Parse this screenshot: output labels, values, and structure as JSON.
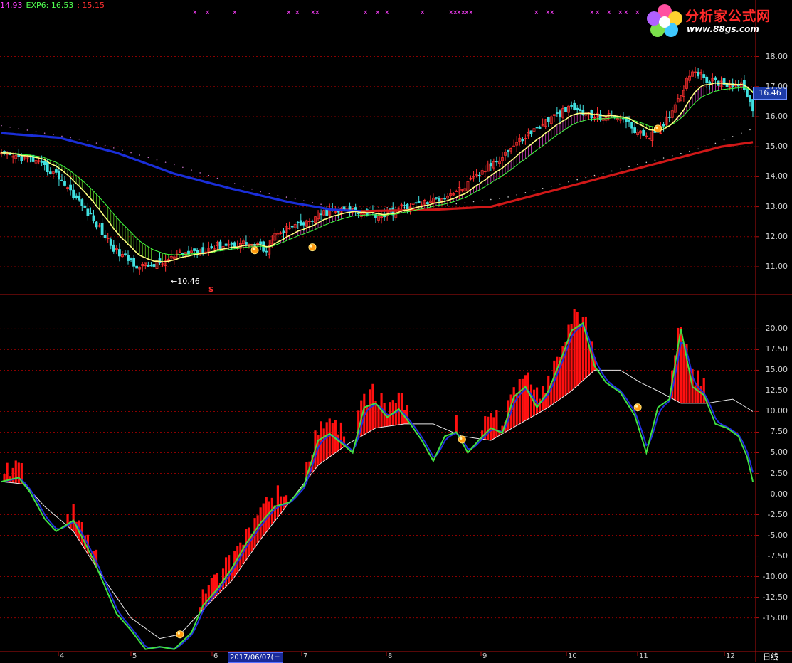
{
  "header": {
    "values": [
      {
        "text": "14.93",
        "color": "#ff40ff"
      },
      {
        "text": "EXP6: 16.53",
        "color": "#50ff50"
      },
      {
        "text": ": 15.15",
        "color": "#ff3030"
      }
    ]
  },
  "logo": {
    "title": "分析家公式网",
    "url": "www.88gs.com"
  },
  "price_tag": "16.46",
  "low_label": "10.46",
  "signal_label": "S",
  "date_box": "2017/06/07(三",
  "period_label": "日线",
  "colors": {
    "up": "#ff3030",
    "down": "#40e0e0",
    "grid": "#8a0000",
    "ma_long": "#1a2ed8",
    "ma_red": "#d01818",
    "ema_fast": "#ffff80"
  },
  "chart_data": [
    {
      "type": "candlestick",
      "panel": "price",
      "y_ticks": [
        "18.00",
        "17.00",
        "16.00",
        "15.00",
        "14.00",
        "13.00",
        "12.00",
        "11.00"
      ],
      "ylim": [
        10.1,
        18.7
      ],
      "x_ticks": [
        "4",
        "5",
        "6",
        "7",
        "8",
        "9",
        "10",
        "11",
        "12"
      ],
      "close_anchors": [
        [
          0,
          14.7
        ],
        [
          10,
          14.6
        ],
        [
          20,
          14.0
        ],
        [
          30,
          12.8
        ],
        [
          40,
          11.5
        ],
        [
          48,
          11.0
        ],
        [
          55,
          11.1
        ],
        [
          62,
          11.4
        ],
        [
          75,
          11.7
        ],
        [
          85,
          11.8
        ],
        [
          92,
          11.6
        ],
        [
          96,
          12.2
        ],
        [
          105,
          12.4
        ],
        [
          112,
          12.8
        ],
        [
          122,
          12.9
        ],
        [
          132,
          12.7
        ],
        [
          140,
          13.0
        ],
        [
          150,
          13.2
        ],
        [
          160,
          13.6
        ],
        [
          170,
          14.4
        ],
        [
          180,
          15.2
        ],
        [
          190,
          15.9
        ],
        [
          198,
          16.3
        ],
        [
          205,
          16.0
        ],
        [
          215,
          16.0
        ],
        [
          222,
          15.4
        ],
        [
          228,
          15.4
        ],
        [
          235,
          16.6
        ],
        [
          240,
          17.6
        ],
        [
          245,
          17.2
        ],
        [
          252,
          17.1
        ],
        [
          258,
          17.0
        ],
        [
          261,
          16.1
        ]
      ],
      "series": [
        {
          "name": "MA-long",
          "color": "#1a2ed8"
        },
        {
          "name": "EMA",
          "color": "#ffff80"
        },
        {
          "name": "MA-red",
          "color": "#d01818"
        }
      ],
      "signal_points": [
        {
          "x": 88,
          "y": 11.55
        },
        {
          "x": 108,
          "y": 11.65
        },
        {
          "x": 228,
          "y": 15.6
        }
      ]
    },
    {
      "type": "bar+line",
      "panel": "oscillator",
      "y_ticks": [
        "20.00",
        "17.50",
        "15.00",
        "12.50",
        "10.00",
        "7.50",
        "5.00",
        "2.50",
        "0.00",
        "-2.50",
        "-5.00",
        "-7.50",
        "-10.00",
        "-12.50",
        "-15.00"
      ],
      "ylim": [
        -19,
        24
      ],
      "green_anchors": [
        [
          0,
          1.5
        ],
        [
          6,
          2.0
        ],
        [
          10,
          0.2
        ],
        [
          15,
          -3.0
        ],
        [
          19,
          -4.5
        ],
        [
          25,
          -3.2
        ],
        [
          32,
          -8.0
        ],
        [
          40,
          -14.5
        ],
        [
          45,
          -16.5
        ],
        [
          50,
          -18.8
        ],
        [
          55,
          -18.5
        ],
        [
          60,
          -18.8
        ],
        [
          66,
          -16.8
        ],
        [
          70,
          -13.5
        ],
        [
          75,
          -11.5
        ],
        [
          80,
          -9.0
        ],
        [
          85,
          -6.0
        ],
        [
          90,
          -3.5
        ],
        [
          95,
          -1.5
        ],
        [
          100,
          -1.0
        ],
        [
          105,
          1.0
        ],
        [
          110,
          6.5
        ],
        [
          114,
          7.3
        ],
        [
          118,
          6.2
        ],
        [
          122,
          5.0
        ],
        [
          126,
          10.5
        ],
        [
          130,
          11.0
        ],
        [
          134,
          9.3
        ],
        [
          138,
          10.3
        ],
        [
          142,
          8.5
        ],
        [
          146,
          6.5
        ],
        [
          150,
          4.0
        ],
        [
          154,
          7.0
        ],
        [
          158,
          7.5
        ],
        [
          162,
          5.0
        ],
        [
          166,
          6.6
        ],
        [
          170,
          8.0
        ],
        [
          174,
          7.4
        ],
        [
          178,
          11.8
        ],
        [
          182,
          13.0
        ],
        [
          186,
          10.5
        ],
        [
          190,
          12.5
        ],
        [
          194,
          16.0
        ],
        [
          198,
          19.8
        ],
        [
          202,
          20.7
        ],
        [
          206,
          15.5
        ],
        [
          210,
          13.5
        ],
        [
          215,
          12.3
        ],
        [
          220,
          9.5
        ],
        [
          224,
          5.0
        ],
        [
          228,
          10.5
        ],
        [
          232,
          11.5
        ],
        [
          236,
          20.0
        ],
        [
          240,
          13.0
        ],
        [
          244,
          12.0
        ],
        [
          248,
          8.5
        ],
        [
          252,
          8.0
        ],
        [
          256,
          7.0
        ],
        [
          259,
          4.5
        ],
        [
          261,
          1.5
        ]
      ],
      "white_anchors": [
        [
          0,
          1.5
        ],
        [
          8,
          1.2
        ],
        [
          15,
          -1.5
        ],
        [
          25,
          -4.5
        ],
        [
          35,
          -10.0
        ],
        [
          45,
          -15.0
        ],
        [
          55,
          -17.5
        ],
        [
          62,
          -17.0
        ],
        [
          70,
          -14.0
        ],
        [
          80,
          -10.5
        ],
        [
          90,
          -5.5
        ],
        [
          100,
          -1.0
        ],
        [
          110,
          3.5
        ],
        [
          120,
          6.0
        ],
        [
          130,
          8.0
        ],
        [
          140,
          8.5
        ],
        [
          150,
          8.5
        ],
        [
          160,
          7.0
        ],
        [
          170,
          6.5
        ],
        [
          180,
          8.5
        ],
        [
          190,
          10.5
        ],
        [
          198,
          12.5
        ],
        [
          206,
          15.0
        ],
        [
          215,
          15.0
        ],
        [
          222,
          13.5
        ],
        [
          228,
          12.5
        ],
        [
          236,
          11.0
        ],
        [
          245,
          11.0
        ],
        [
          254,
          11.5
        ],
        [
          261,
          10.0
        ]
      ],
      "signal_points": [
        {
          "x": 62,
          "y": -17.0
        },
        {
          "x": 160,
          "y": 6.6
        },
        {
          "x": 221,
          "y": 10.5
        }
      ]
    }
  ]
}
